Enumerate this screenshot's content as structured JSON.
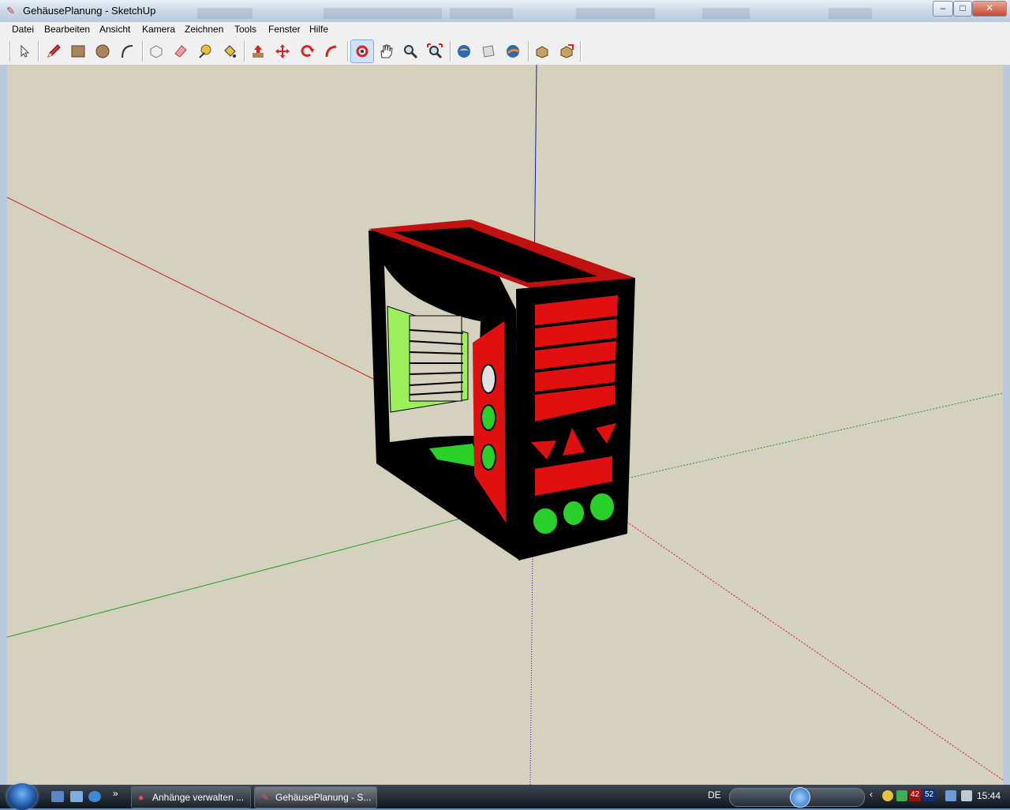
{
  "window": {
    "title": "GehäusePlanung - SketchUp"
  },
  "menu": [
    "Datei",
    "Bearbeiten",
    "Ansicht",
    "Kamera",
    "Zeichnen",
    "Tools",
    "Fenster",
    "Hilfe"
  ],
  "toolbar": {
    "tools": [
      "select",
      "pencil",
      "rectangle",
      "circle",
      "arc",
      "make-component",
      "eraser",
      "tape-measure",
      "paint-bucket",
      "push-pull",
      "move",
      "rotate",
      "follow-me",
      "orbit",
      "pan",
      "zoom",
      "zoom-extents",
      "get-models",
      "share-model",
      "google-earth",
      "components",
      "share-component"
    ],
    "active_tool": "orbit"
  },
  "scene": {
    "description_colors": {
      "frame": "#000000",
      "trim": "#e01010",
      "vents": "#2ad02a",
      "background": "#d4d1be"
    }
  },
  "taskbar": {
    "tasks": [
      "Anhänge verwalten ...",
      "GehäusePlanung - S..."
    ],
    "active_task": 1,
    "language": "DE",
    "clock": "15:44",
    "counter_1": "42",
    "counter_2": "52"
  }
}
